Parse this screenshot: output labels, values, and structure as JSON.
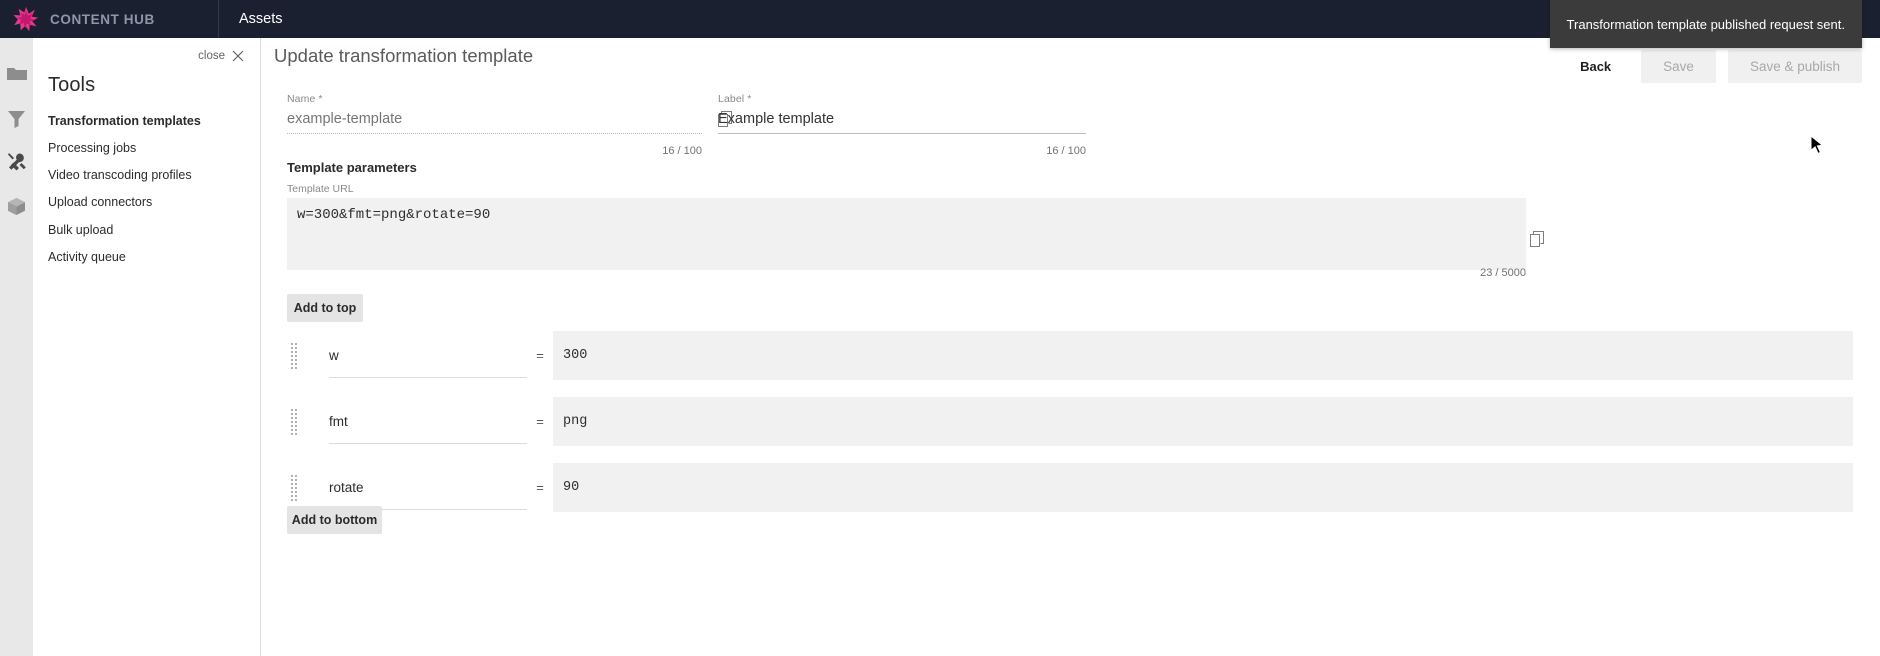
{
  "topbar": {
    "brand": "CONTENT HUB",
    "logo_icon": "starburst-logo-icon",
    "section": "Assets"
  },
  "rail": {
    "items": [
      {
        "icon": "folder-icon",
        "name": "folder"
      },
      {
        "icon": "filter-icon",
        "name": "filter"
      },
      {
        "icon": "tools-icon",
        "name": "tools"
      },
      {
        "icon": "package-icon",
        "name": "package"
      }
    ]
  },
  "tools": {
    "close_label": "close",
    "close_icon": "close-x-icon",
    "title": "Tools",
    "items": [
      {
        "label": "Transformation templates",
        "active": true
      },
      {
        "label": "Processing jobs",
        "active": false
      },
      {
        "label": "Video transcoding profiles",
        "active": false
      },
      {
        "label": "Upload connectors",
        "active": false
      },
      {
        "label": "Bulk upload",
        "active": false
      },
      {
        "label": "Activity queue",
        "active": false
      }
    ]
  },
  "page": {
    "title": "Update transformation template"
  },
  "header_actions": {
    "back": "Back",
    "save": "Save",
    "save_publish": "Save & publish"
  },
  "form": {
    "name": {
      "caption": "Name *",
      "value": "",
      "placeholder": "example-template",
      "counter": "16 / 100",
      "copy_icon": "copy-icon"
    },
    "label": {
      "caption": "Label *",
      "value": "Example template",
      "placeholder": "",
      "counter": "16 / 100"
    }
  },
  "parameters": {
    "heading": "Template parameters",
    "url_caption": "Template URL",
    "url_value": "w=300&fmt=png&rotate=90",
    "url_counter": "23 / 5000",
    "url_copy_icon": "copy-icon",
    "add_top": "Add to top",
    "add_bottom": "Add to bottom",
    "equals": "=",
    "drag_icon": "drag-handle-icon",
    "rows": [
      {
        "key": "w",
        "value": "300"
      },
      {
        "key": "fmt",
        "value": "png"
      },
      {
        "key": "rotate",
        "value": "90"
      }
    ]
  },
  "toast": {
    "message": "Transformation template published request sent."
  },
  "colors": {
    "topbar_bg": "#1b2030",
    "brand_pink": "#e8368f",
    "toast_bg": "#3b3b3b",
    "field_bg": "#f1f1f1",
    "button_bg": "#e4e4e4"
  }
}
